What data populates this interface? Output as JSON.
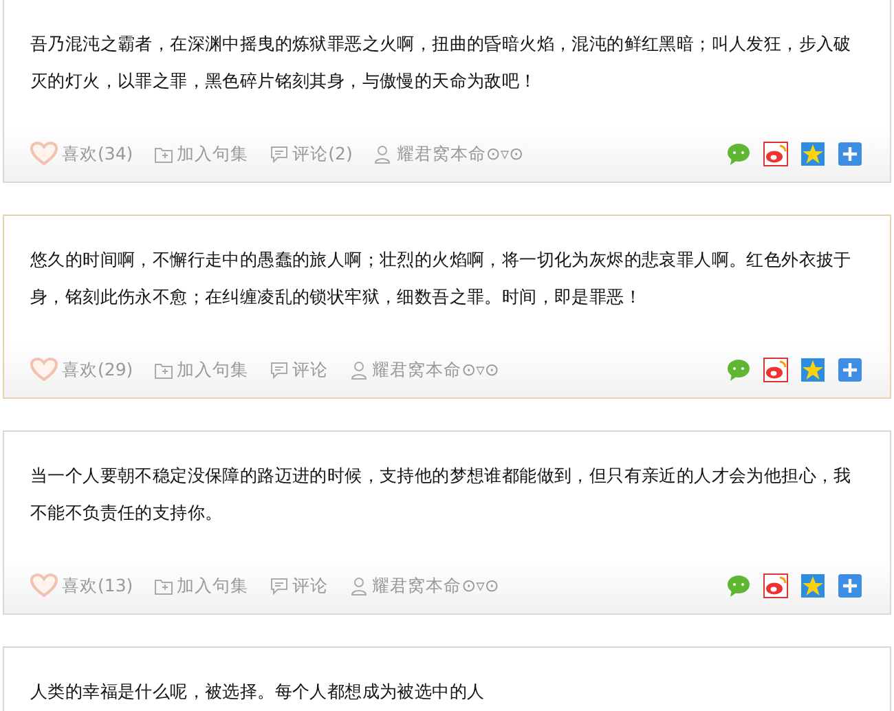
{
  "posts": [
    {
      "text": "吾乃混沌之霸者，在深渊中摇曳的炼狱罪恶之火啊，扭曲的昏暗火焰，混沌的鲜红黑暗；叫人发狂，步入破灭的灯火，以罪之罪，黑色碎片铭刻其身，与傲慢的天命为敌吧！",
      "highlighted": false,
      "footer": {
        "like": "喜欢(34)",
        "collect": "加入句集",
        "comment": "评论(2)",
        "author": "耀君窝本命⊙▿⊙"
      }
    },
    {
      "text": "悠久的时间啊，不懈行走中的愚蠢的旅人啊；壮烈的火焰啊，将一切化为灰烬的悲哀罪人啊。红色外衣披于身，铭刻此伤永不愈；在纠缠凌乱的锁状牢狱，细数吾之罪。时间，即是罪恶！",
      "highlighted": true,
      "footer": {
        "like": "喜欢(29)",
        "collect": "加入句集",
        "comment": "评论",
        "author": "耀君窝本命⊙▿⊙"
      }
    },
    {
      "text": "当一个人要朝不稳定没保障的路迈进的时候，支持他的梦想谁都能做到，但只有亲近的人才会为他担心，我不能不负责任的支持你。",
      "highlighted": false,
      "footer": {
        "like": "喜欢(13)",
        "collect": "加入句集",
        "comment": "评论",
        "author": "耀君窝本命⊙▿⊙"
      }
    },
    {
      "text": "人类的幸福是什么呢，被选择。每个人都想成为被选中的人",
      "highlighted": false
    }
  ]
}
